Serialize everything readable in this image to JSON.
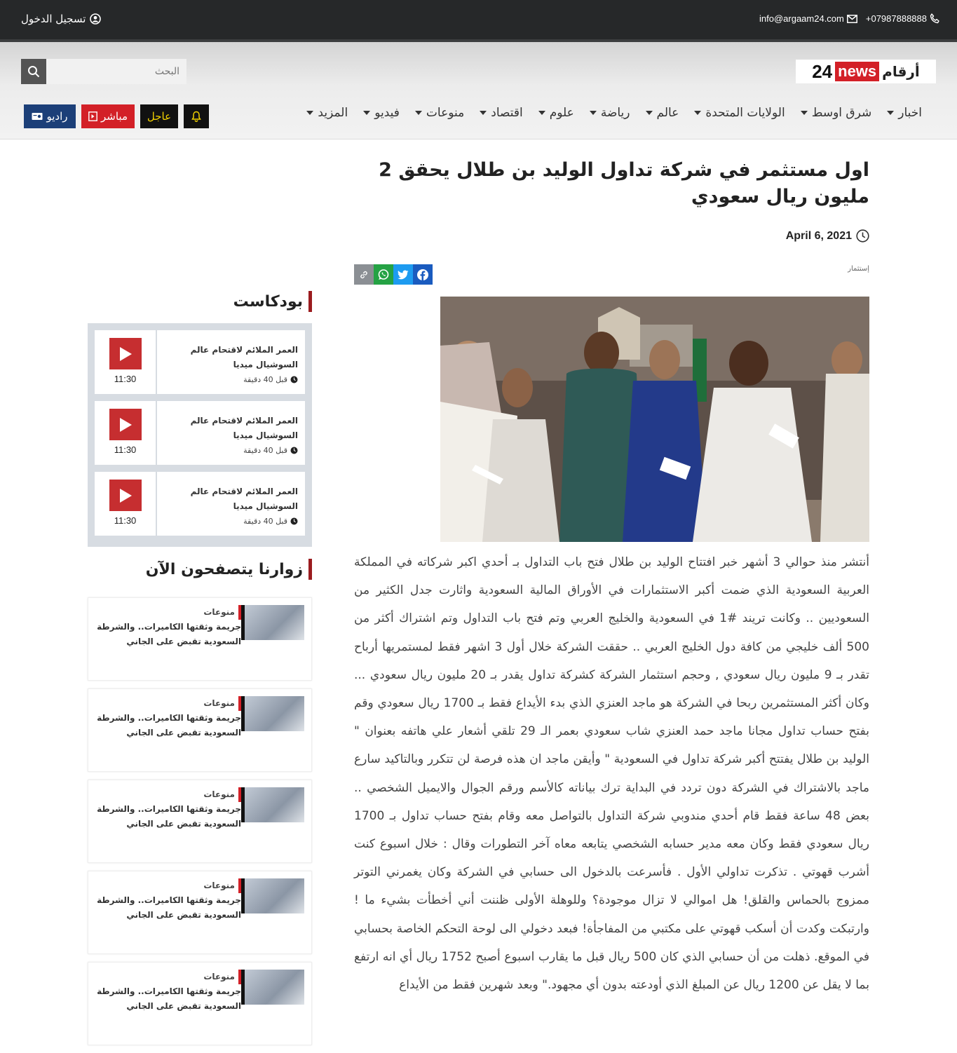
{
  "topbar": {
    "login_label": "تسجيل الدخول",
    "email": "info@argaam24.com",
    "phone": "+07987888888"
  },
  "header": {
    "logo": {
      "ar": "أرقام",
      "news": "news",
      "num": "24"
    },
    "search_placeholder": "البحث",
    "nav": [
      "اخبار",
      "شرق اوسط",
      "الولايات المتحدة",
      "عالم",
      "رياضة",
      "علوم",
      "اقتصاد",
      "منوعات",
      "فيديو",
      "المزيد"
    ],
    "chips": {
      "radio": "راديو",
      "live": "مباشر",
      "breaking": "عاجل"
    }
  },
  "article": {
    "title": "اول مستثمر في شركة تداول الوليد بن طلال يحقق 2 مليون ريال سعودي",
    "date": "April 6, 2021",
    "category": "إستثمار",
    "body": "أنتشر منذ حوالي 3 أشهر خبر افتتاح الوليد بن طلال فتح باب التداول بـ أحدي اكبر شركاته في المملكة العربية السعودية الذي ضمت أكبر الاستثمارات في الأوراق المالية السعودية واثارت جدل الكثير من السعوديين .. وكانت تريند #1 في السعودية والخليج العربي وتم فتح باب التداول وتم اشتراك أكثر من 500 ألف خليجي من كافة دول الخليج العربي .. حققت الشركة خلال أول 3 اشهر فقط لمستمريها أرباح تقدر بـ 9 مليون ريال سعودي , وحجم استثمار الشركة كشركة تداول يقدر بـ 20 مليون ريال سعودي ... وكان أكثر المستثمرين ربحا في الشركة هو ماجد العنزي الذي بدء الأيداع فقط بـ 1700 ريال سعودي وقم بفتح حساب تداول مجانا ماجد حمد العنزي شاب سعودي بعمر الـ 29 تلقي أشعار علي هاتفه بعنوان \" الوليد بن طلال يفتتح أكبر شركة تداول في السعودية \" وأيقن ماجد ان هذه فرصة لن تتكرر وبالتاكيد سارع ماجد بالاشتراك في الشركة دون تردد في البداية ترك بياناته كالأسم ورقم الجوال والايميل الشخصي .. بعض 48 ساعة فقط قام أحدي مندوبي شركة التداول بالتواصل معه وقام بفتح حساب تداول بـ 1700 ريال سعودي فقط وكان معه مدير حسابه الشخصي يتابعه معاه آخر التطورات وقال : خلال اسبوع كنت أشرب قهوتي . تذكرت تداولي الأول . فأسرعت بالدخول الى حسابي في الشركة وكان يغمرني التوتر ممزوج بالحماس والقلق! هل اموالي لا تزال موجودة؟ وللوهلة الأولى ظننت أني أخطأت بشيء ما ! وارتبكت وكدت أن أسكب قهوتي على مكتبي من المفاجأة! فبعد دخولي الى لوحة التحكم الخاصة بحسابي في الموقع. ذهلت من أن حسابي الذي كان 500 ريال قبل ما يقارب اسبوع أصبح 1752 ريال أي انه ارتفع بما لا يقل عن 1200 ريال عن المبلغ الذي أودعته بدون أي مجهود.\" وبعد شهرين فقط من الأيداع"
  },
  "sidebar": {
    "podcast_title": "بودكاست",
    "podcasts": [
      {
        "title": "العمر الملائم لاقتحام عالم السوشيال ميديا",
        "ago": "قبل 40 دقيقة",
        "duration": "11:30"
      },
      {
        "title": "العمر الملائم لاقتحام عالم السوشيال ميديا",
        "ago": "قبل 40 دقيقة",
        "duration": "11:30"
      },
      {
        "title": "العمر الملائم لاقتحام عالم السوشيال ميديا",
        "ago": "قبل 40 دقيقة",
        "duration": "11:30"
      }
    ],
    "visitors_title": "زوارنا يتصفحون الآن",
    "visitors": [
      {
        "category": "منوعات",
        "title": "جريمة وثقتها الكاميرات.. والشرطة السعودية تقبض على الجاني"
      },
      {
        "category": "منوعات",
        "title": "جريمة وثقتها الكاميرات.. والشرطة السعودية تقبض على الجاني"
      },
      {
        "category": "منوعات",
        "title": "جريمة وثقتها الكاميرات.. والشرطة السعودية تقبض على الجاني"
      },
      {
        "category": "منوعات",
        "title": "جريمة وثقتها الكاميرات.. والشرطة السعودية تقبض على الجاني"
      },
      {
        "category": "منوعات",
        "title": "جريمة وثقتها الكاميرات.. والشرطة السعودية تقبض على الجاني"
      }
    ]
  },
  "colors": {
    "brand_red": "#d32027",
    "dark": "#262829",
    "radio_blue": "#1c3f78",
    "breaking_yellow": "#f2d100"
  }
}
